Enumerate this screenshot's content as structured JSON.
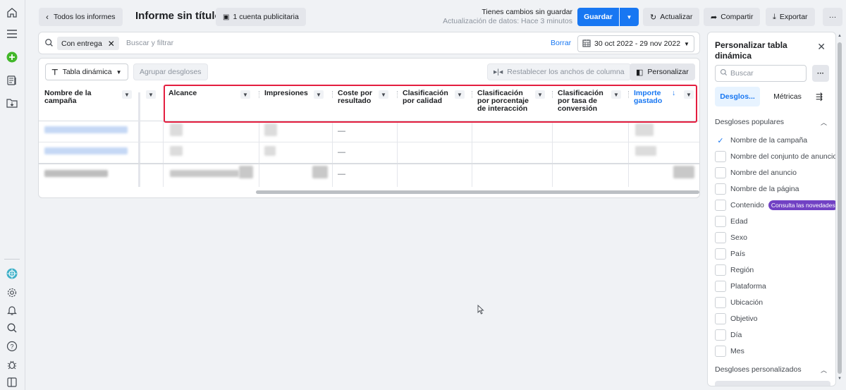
{
  "topbar": {
    "back_label": "Todos los informes",
    "title": "Informe sin título",
    "accounts_label": "1 cuenta publicitaria",
    "unsaved_title": "Tienes cambios sin guardar",
    "unsaved_sub": "Actualización de datos: Hace 3 minutos",
    "save_label": "Guardar",
    "refresh_label": "Actualizar",
    "share_label": "Compartir",
    "export_label": "Exportar",
    "more_label": "···"
  },
  "filter": {
    "chip_label": "Con entrega",
    "placeholder": "Buscar y filtrar",
    "clear_label": "Borrar",
    "date_range": "30 oct 2022 - 29 nov 2022"
  },
  "toolbar": {
    "pivot_label": "Tabla dinámica",
    "group_label": "Agrupar desgloses",
    "reset_widths_label": "Restablecer los anchos de columna",
    "customize_label": "Personalizar"
  },
  "table": {
    "columns": [
      "Nombre de la campaña",
      "Alcance",
      "Impresiones",
      "Coste por resultado",
      "Clasificación por calidad",
      "Clasificación por porcentaje de interacción",
      "Clasificación por tasa de conversión",
      "Importe gastado"
    ],
    "sorted_indicator": "↓",
    "dash": "—"
  },
  "panel": {
    "title": "Personalizar tabla dinámica",
    "search_placeholder": "Buscar",
    "more_label": "···",
    "tab_breakdowns": "Desglos...",
    "tab_metrics": "Métricas",
    "popular_header": "Desgloses populares",
    "custom_header": "Desgloses personalizados",
    "new_badge": "Consulta las novedades",
    "items": [
      {
        "label": "Nombre de la campaña",
        "checked": true
      },
      {
        "label": "Nombre del conjunto de anuncios",
        "checked": false
      },
      {
        "label": "Nombre del anuncio",
        "checked": false
      },
      {
        "label": "Nombre de la página",
        "checked": false
      },
      {
        "label": "Contenido",
        "checked": false
      },
      {
        "label": "Edad",
        "checked": false
      },
      {
        "label": "Sexo",
        "checked": false
      },
      {
        "label": "País",
        "checked": false
      },
      {
        "label": "Región",
        "checked": false
      },
      {
        "label": "Plataforma",
        "checked": false
      },
      {
        "label": "Ubicación",
        "checked": false
      },
      {
        "label": "Objetivo",
        "checked": false
      },
      {
        "label": "Día",
        "checked": false
      },
      {
        "label": "Mes",
        "checked": false
      }
    ]
  },
  "colors": {
    "accent": "#1877f2",
    "highlight": "#e41e3f",
    "badge": "#7141c4"
  }
}
